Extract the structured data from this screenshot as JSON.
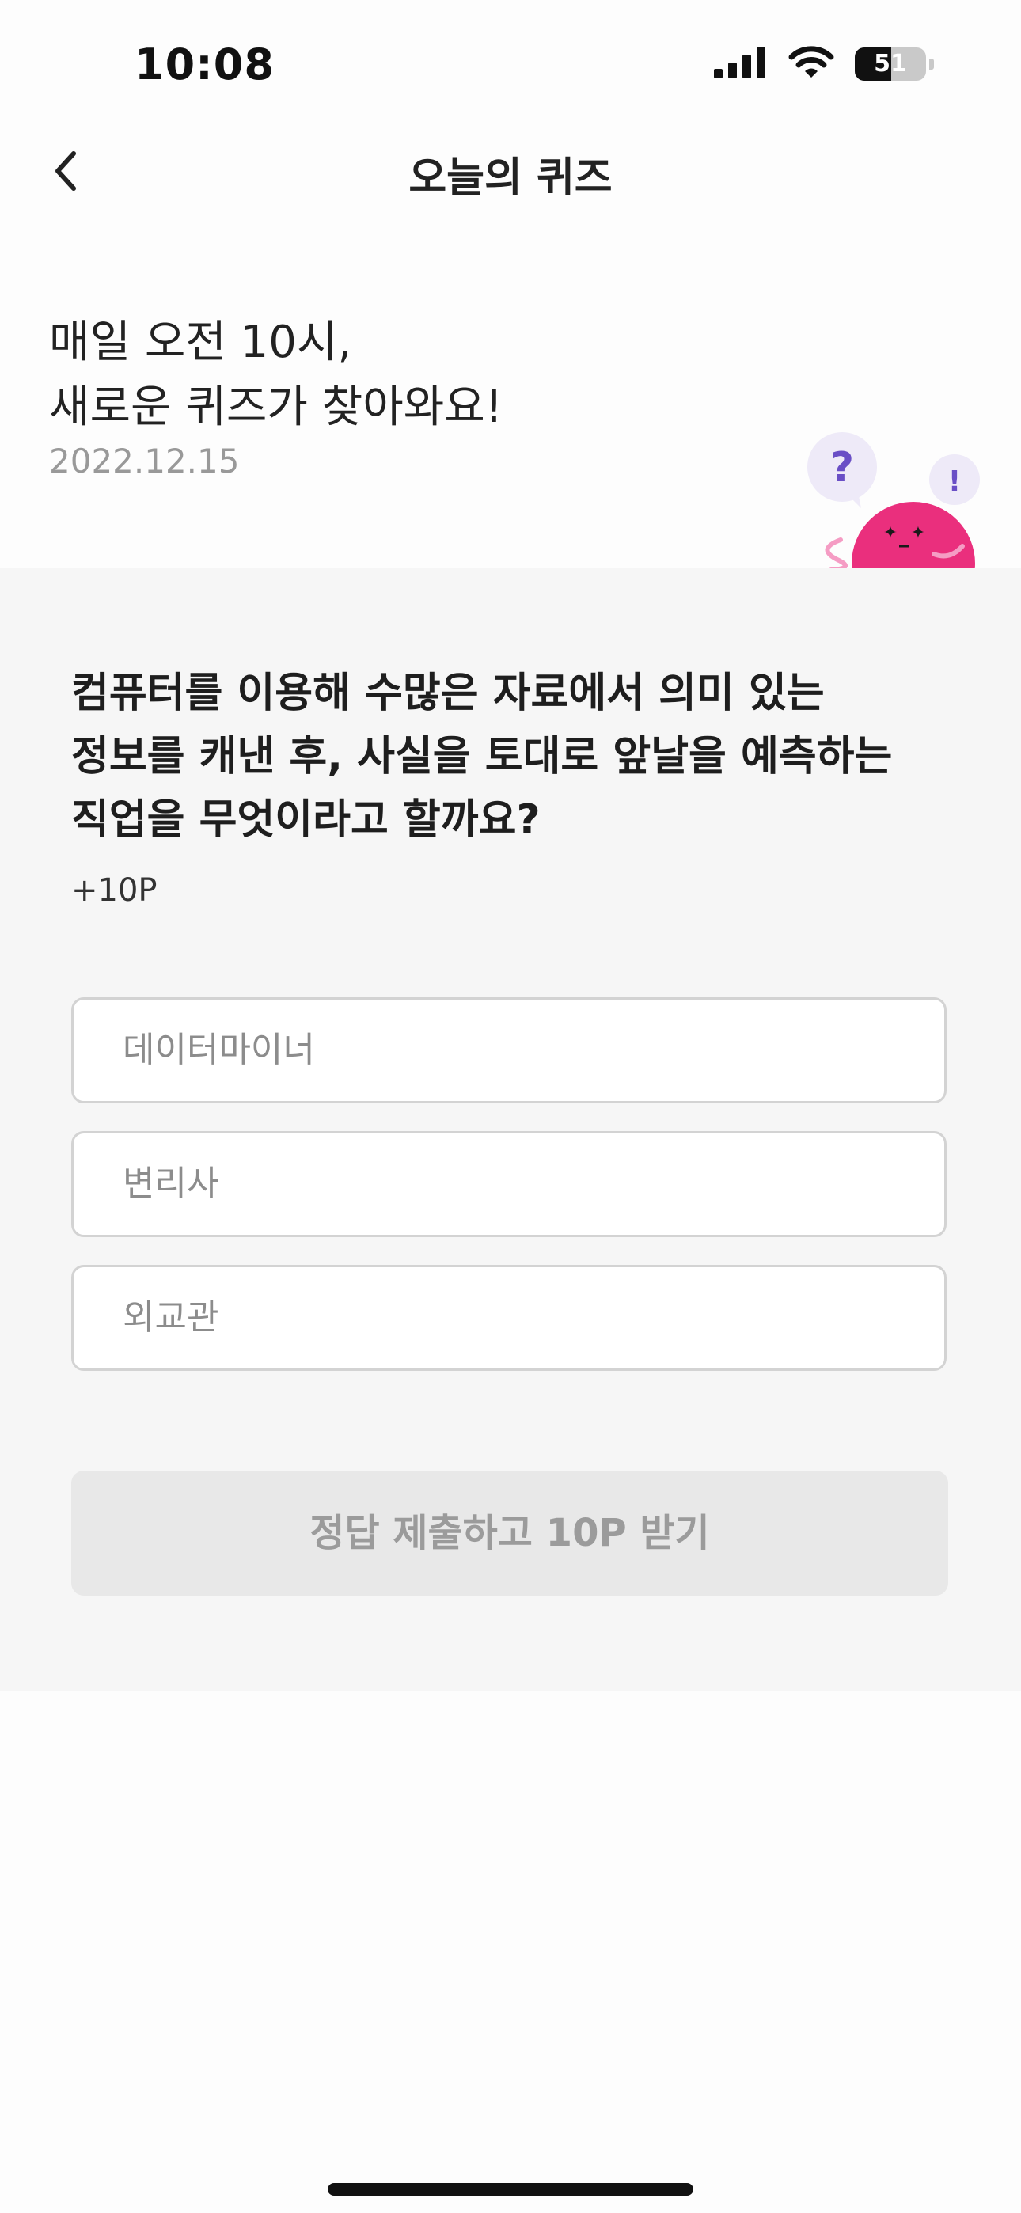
{
  "status_bar": {
    "time": "10:08",
    "battery_level": "51",
    "icons": [
      "cellular-signal-icon",
      "wifi-icon",
      "battery-icon"
    ]
  },
  "header": {
    "title": "오늘의 퀴즈",
    "back_icon": "chevron-left-icon"
  },
  "intro": {
    "line1": "매일 오전 10시,",
    "line2": "새로운 퀴즈가 찾아와요!",
    "date": "2022.12.15",
    "mascot_icon": "quiz-mascot-icon"
  },
  "quiz": {
    "question": "컴퓨터를 이용해 수많은 자료에서 의미 있는 정보를 캐낸 후, 사실을 토대로 앞날을 예측하는 직업을 무엇이라고 할까요?",
    "points": "+10P",
    "options": [
      {
        "label": "데이터마이너"
      },
      {
        "label": "변리사"
      },
      {
        "label": "외교관"
      }
    ],
    "submit_label": "정답 제출하고 10P 받기"
  },
  "colors": {
    "panel_background": "#f6f6f6",
    "mascot_pink": "#ea2f7d",
    "mascot_accent": "#6a4fc6",
    "submit_disabled_bg": "#e8e8e8",
    "submit_disabled_text": "#9b9b9b"
  }
}
